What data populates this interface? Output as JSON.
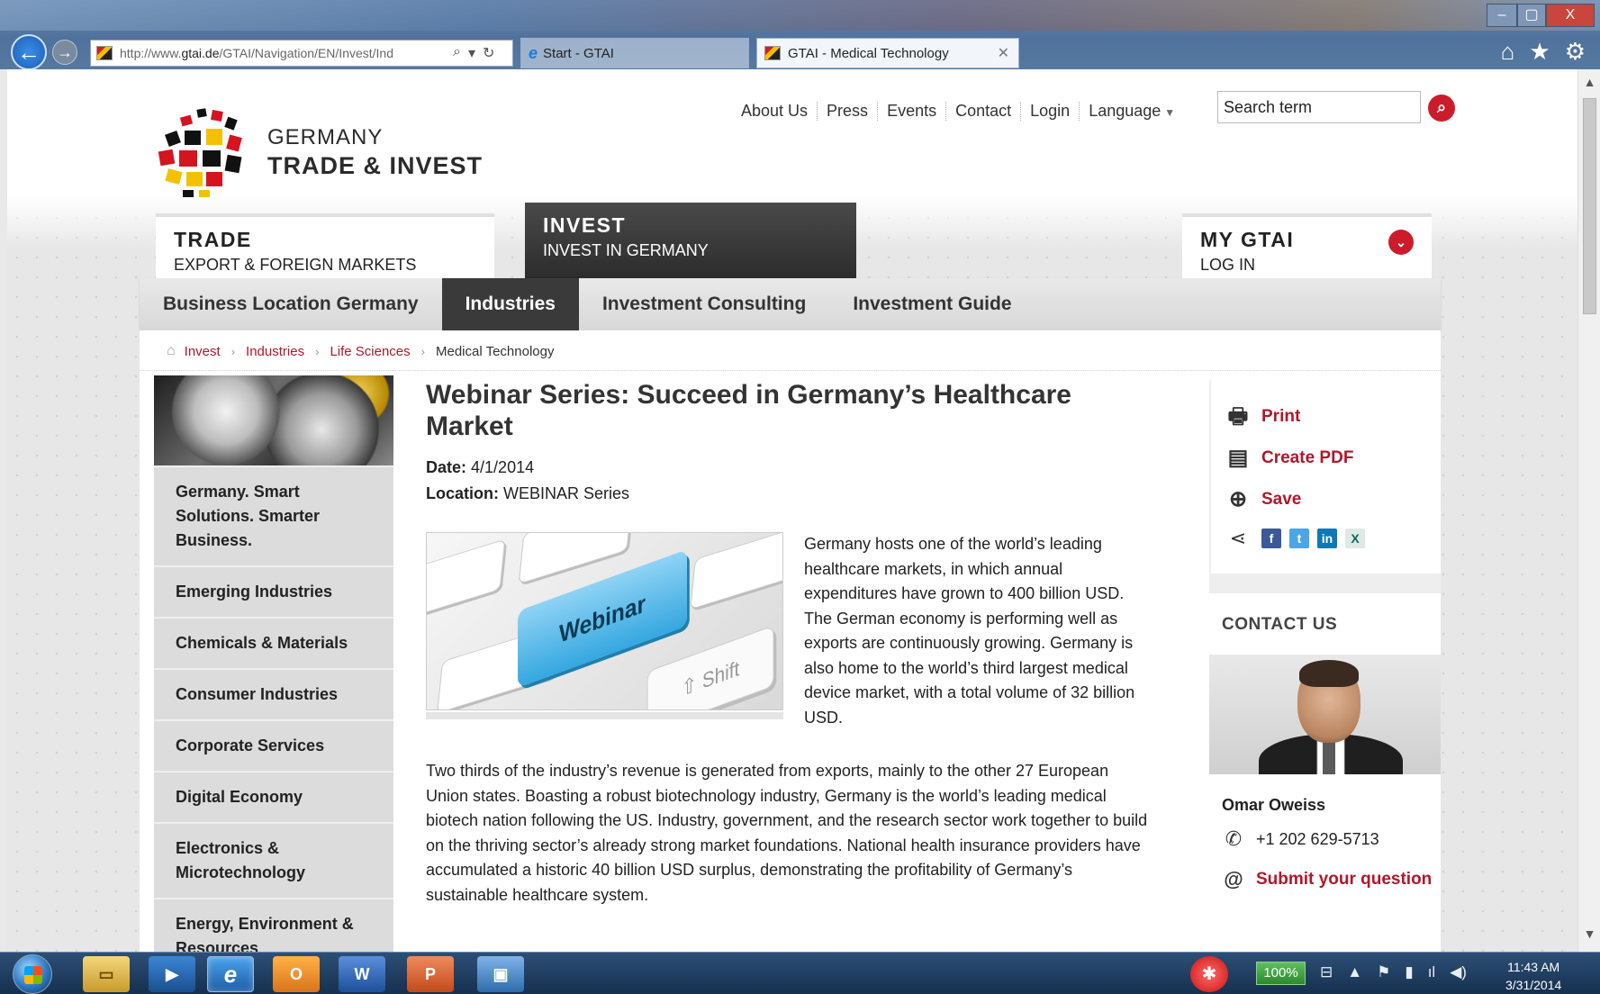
{
  "browser": {
    "url_prefix": "http://www.",
    "url_domain": "gtai.de",
    "url_rest": "/GTAI/Navigation/EN/Invest/Ind",
    "tabs": [
      {
        "label": "Start - GTAI"
      },
      {
        "label": "GTAI - Medical Technology"
      }
    ],
    "close_glyph": "✕",
    "window_buttons": {
      "minimize": "–",
      "maximize": "▢",
      "close": "X"
    }
  },
  "header": {
    "logo_line1": "GERMANY",
    "logo_line2": "TRADE & INVEST",
    "service_nav": [
      "About Us",
      "Press",
      "Events",
      "Contact",
      "Login",
      "Language"
    ],
    "search_placeholder": "Search term"
  },
  "main_tabs": {
    "trade": {
      "title": "TRADE",
      "sub": "EXPORT & FOREIGN MARKETS"
    },
    "invest": {
      "title": "INVEST",
      "sub": "INVEST IN GERMANY"
    },
    "mygtai": {
      "title": "MY GTAI",
      "sub": "LOG IN"
    }
  },
  "subnav": [
    "Business Location Germany",
    "Industries",
    "Investment Consulting",
    "Investment Guide"
  ],
  "breadcrumb": [
    "Invest",
    "Industries",
    "Life Sciences",
    "Medical Technology"
  ],
  "leftnav": [
    "Germany. Smart Solutions. Smarter Business.",
    "Emerging Industries",
    "Chemicals & Materials",
    "Consumer Industries",
    "Corporate Services",
    "Digital Economy",
    "Electronics & Microtechnology",
    "Energy, Environment & Resources"
  ],
  "article": {
    "title": "Webinar Series: Succeed in Germany’s Healthcare Market",
    "date_label": "Date:",
    "date_value": "4/1/2014",
    "location_label": "Location:",
    "location_value": "WEBINAR Series",
    "figure_key_label": "Webinar",
    "figure_shift_label": "⇧ Shift",
    "para1": "Germany hosts one of the world’s leading healthcare markets, in which annual expenditures have grown to 400 billion USD. The German economy is performing well as exports are continuously growing. Germany is also home to the world’s third largest medical device market, with a total volume of 32 billion USD.",
    "para2": "Two thirds of the industry’s revenue is generated from exports, mainly to the other 27 European Union states. Boasting a robust biotechnology industry, Germany is the world’s leading medical biotech nation following the US. Industry, government, and the research sector work together to build on the thriving sector’s already strong market foundations. National health insurance providers have accumulated a historic 40 billion USD surplus, demonstrating the profitability of Germany’s sustainable healthcare system."
  },
  "tools": {
    "print": "Print",
    "pdf": "Create PDF",
    "save": "Save"
  },
  "contact": {
    "title": "CONTACT US",
    "name": "Omar Oweiss",
    "phone": "+1 202 629-5713",
    "submit": "Submit your question"
  },
  "taskbar": {
    "battery": "100%",
    "time": "11:43 AM",
    "date": "3/31/2014"
  }
}
